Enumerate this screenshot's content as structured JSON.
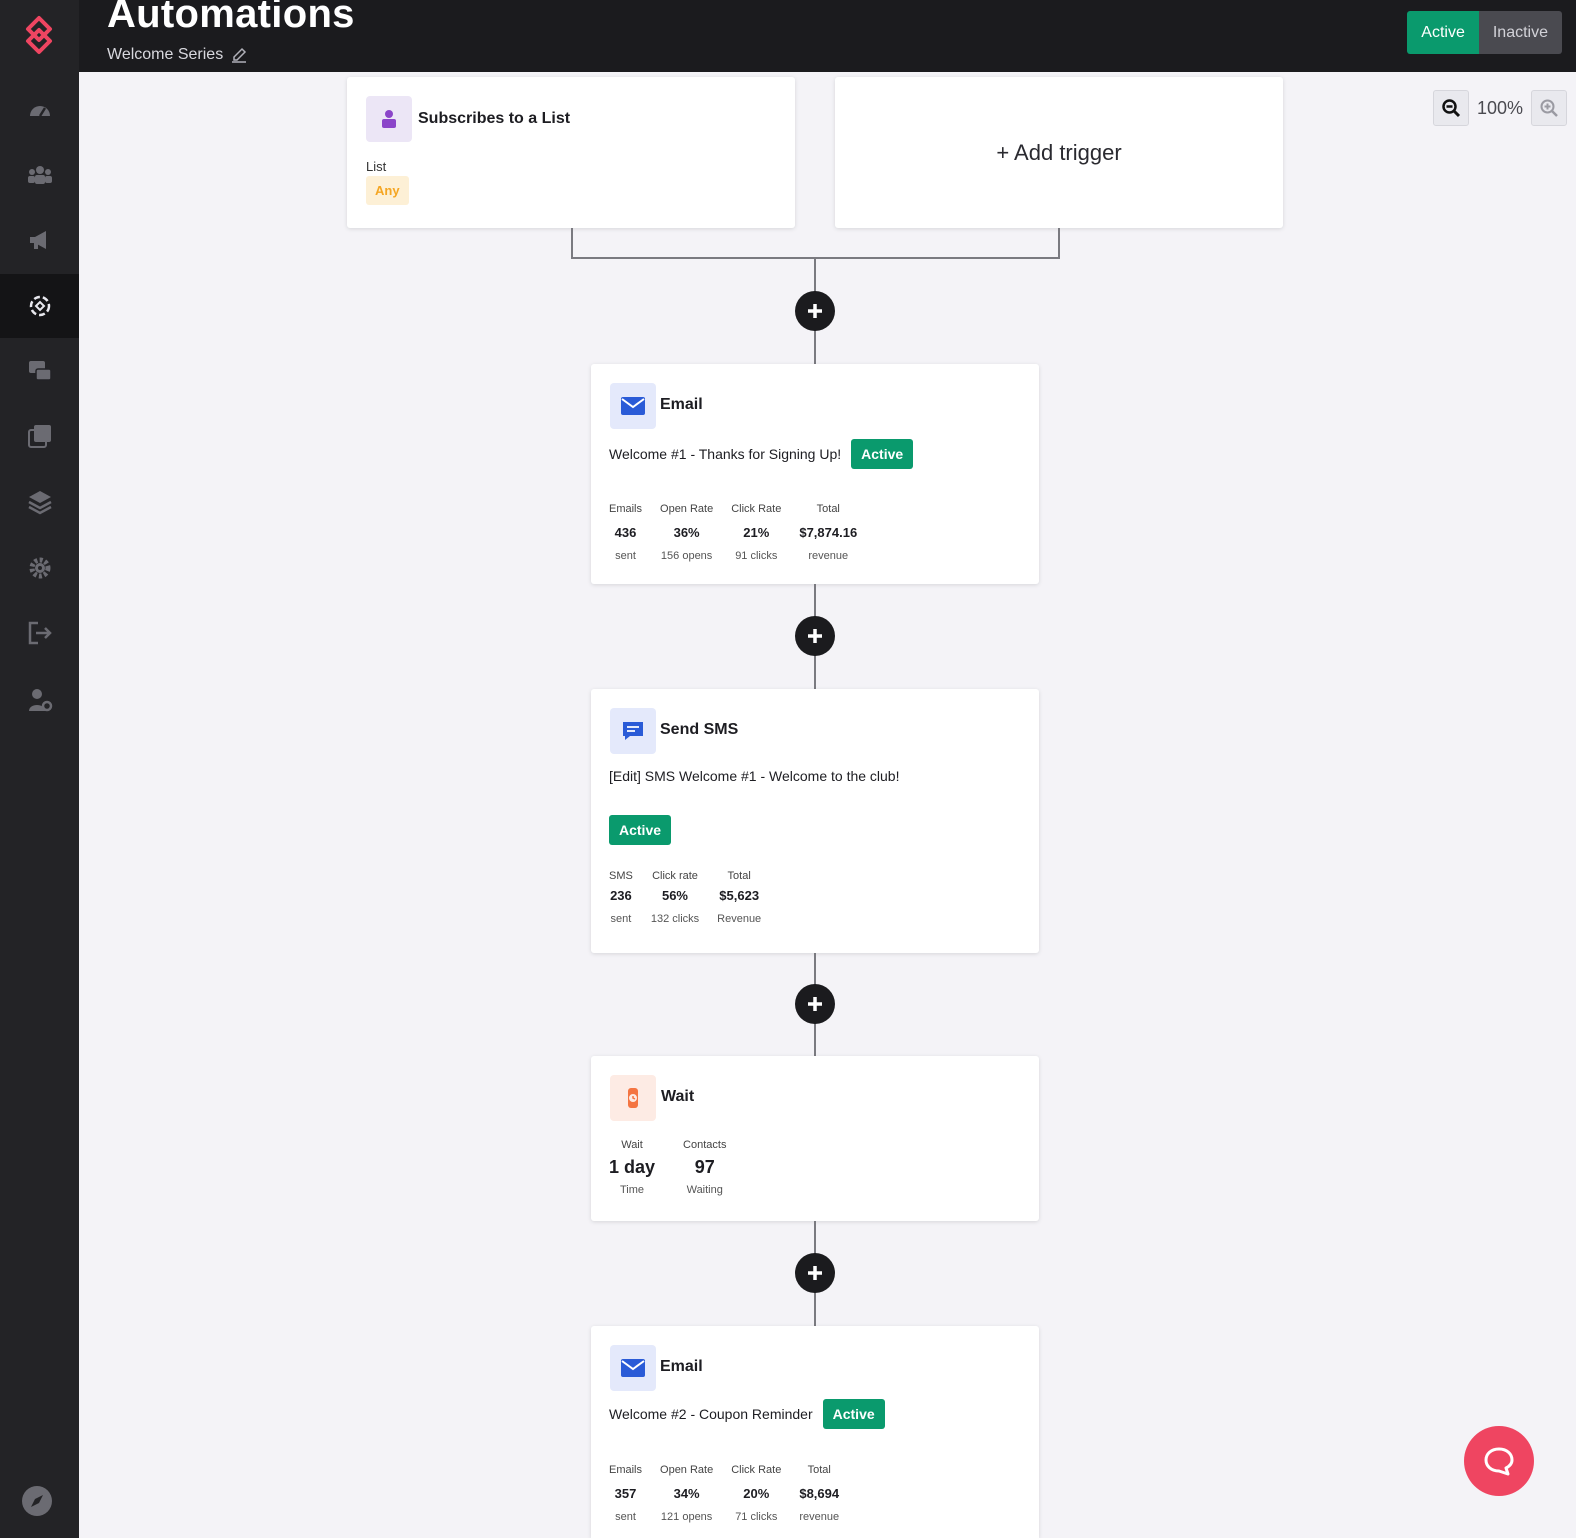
{
  "header": {
    "title": "Automations",
    "subtitle": "Welcome Series",
    "toggle_active": "Active",
    "toggle_inactive": "Inactive"
  },
  "zoom": {
    "level": "100%"
  },
  "trigger": {
    "title": "Subscribes to a List",
    "field_label": "List",
    "field_value": "Any",
    "add_label": "+ Add trigger"
  },
  "steps": [
    {
      "title": "Email",
      "name": "Welcome #1 - Thanks for Signing Up!",
      "status": "Active",
      "stats": [
        {
          "label": "Emails",
          "value": "436",
          "sub": "sent"
        },
        {
          "label": "Open Rate",
          "value": "36%",
          "sub": "156 opens"
        },
        {
          "label": "Click Rate",
          "value": "21%",
          "sub": "91 clicks"
        },
        {
          "label": "Total",
          "value": "$7,874.16",
          "sub": "revenue"
        }
      ]
    },
    {
      "title": "Send SMS",
      "name": "[Edit] SMS Welcome #1 - Welcome to the club!",
      "status": "Active",
      "stats": [
        {
          "label": "SMS",
          "value": "236",
          "sub": "sent"
        },
        {
          "label": "Click rate",
          "value": "56%",
          "sub": "132 clicks"
        },
        {
          "label": "Total",
          "value": "$5,623",
          "sub": "Revenue"
        }
      ]
    },
    {
      "title": "Wait",
      "stats": [
        {
          "label": "Wait",
          "value": "1 day",
          "sub": "Time"
        },
        {
          "label": "Contacts",
          "value": "97",
          "sub": "Waiting"
        }
      ]
    },
    {
      "title": "Email",
      "name": "Welcome #2 - Coupon Reminder",
      "status": "Active",
      "stats": [
        {
          "label": "Emails",
          "value": "357",
          "sub": "sent"
        },
        {
          "label": "Open Rate",
          "value": "34%",
          "sub": "121 opens"
        },
        {
          "label": "Click Rate",
          "value": "20%",
          "sub": "71 clicks"
        },
        {
          "label": "Total",
          "value": "$8,694",
          "sub": "revenue"
        }
      ]
    }
  ],
  "colors": {
    "brand": "#ef4561",
    "active_green": "#0a9a6d",
    "sidebar_bg": "#232326",
    "header_bg": "#1b1b1e",
    "canvas_bg": "#f4f3f7"
  }
}
